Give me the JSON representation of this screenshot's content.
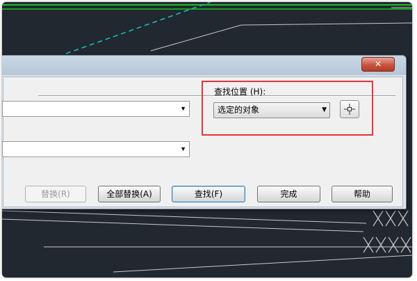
{
  "dialog": {
    "close_label": "✕",
    "find_in": {
      "label": "查找位置 (H):",
      "selected": "选定的对象"
    },
    "buttons": {
      "replace": "替换(R)",
      "replace_all": "全部替换(A)",
      "find": "查找(F)",
      "done": "完成",
      "help": "帮助"
    }
  },
  "icons": {
    "combo_arrow": "▼",
    "pick_objects": "crosshair-icon",
    "close": "close-icon"
  },
  "colors": {
    "highlight": "#e8323a",
    "cad_background": "#212830",
    "cad_green": "#1ec21e",
    "cad_cyan": "#1fb5b5",
    "close_red": "#c8543f"
  }
}
